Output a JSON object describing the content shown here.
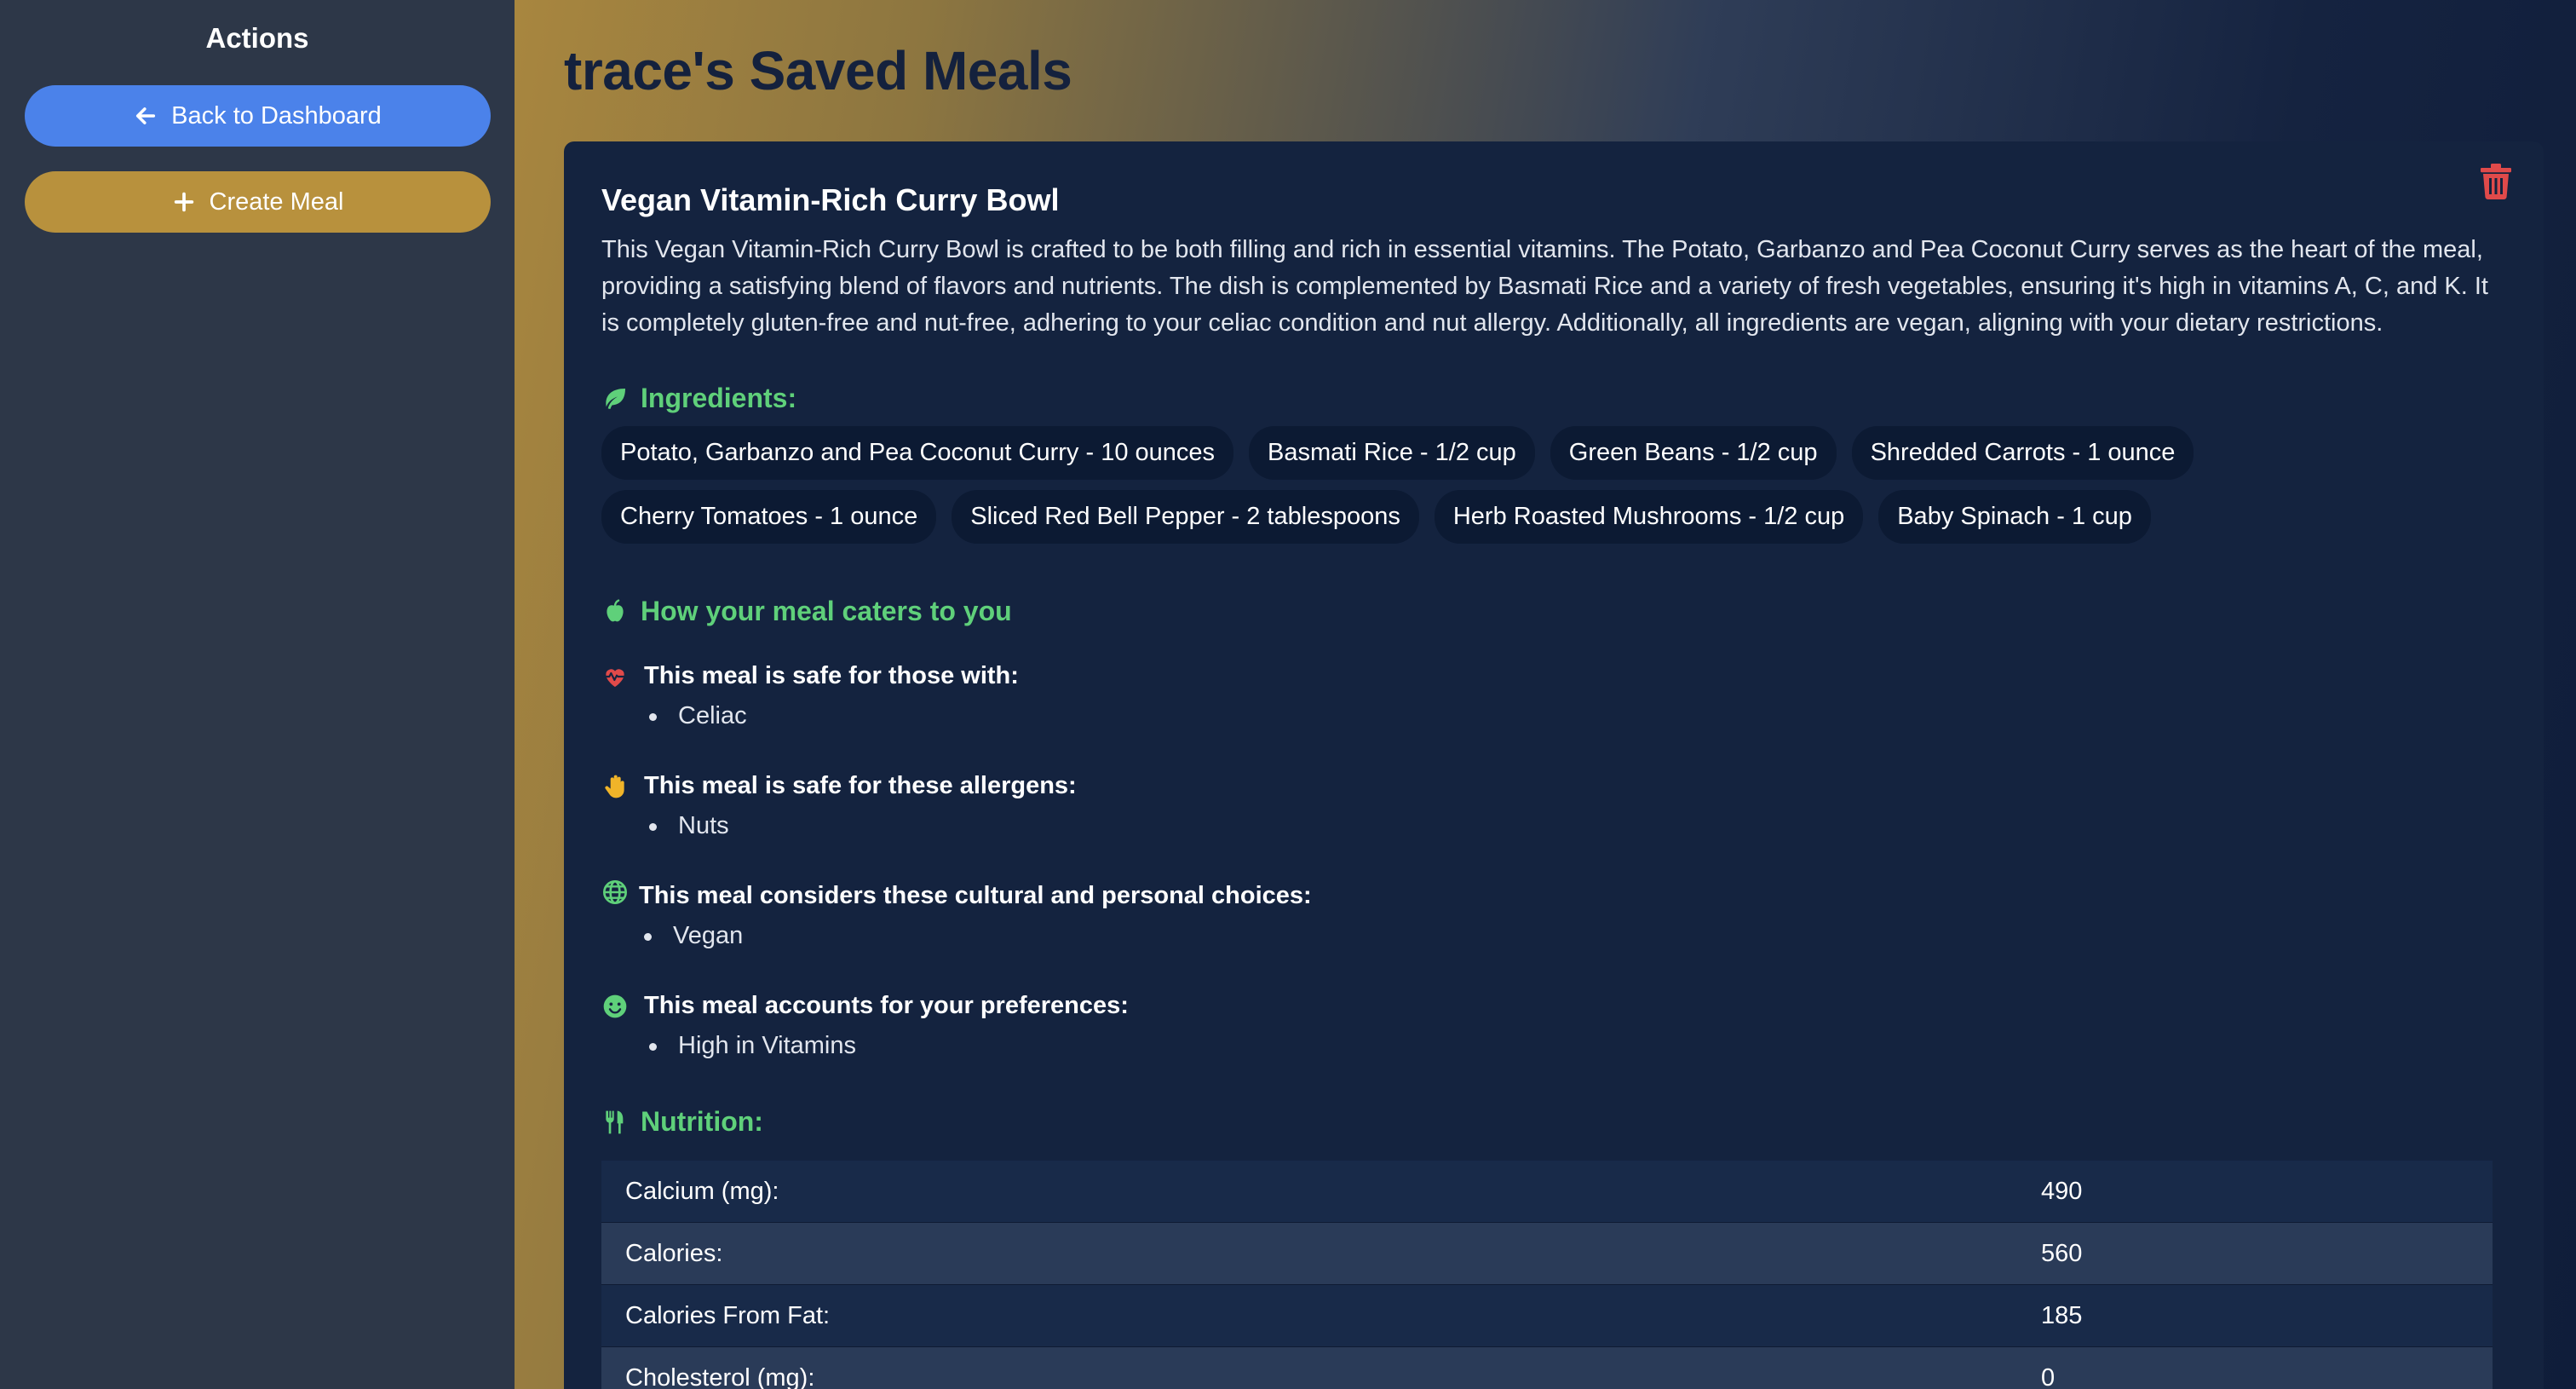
{
  "sidebar": {
    "title": "Actions",
    "back_label": "Back to Dashboard",
    "create_label": "Create Meal"
  },
  "page": {
    "title": "trace's Saved Meals"
  },
  "meal": {
    "name": "Vegan Vitamin-Rich Curry Bowl",
    "description": "This Vegan Vitamin-Rich Curry Bowl is crafted to be both filling and rich in essential vitamins. The Potato, Garbanzo and Pea Coconut Curry serves as the heart of the meal, providing a satisfying blend of flavors and nutrients. The dish is complemented by Basmati Rice and a variety of fresh vegetables, ensuring it's high in vitamins A, C, and K. It is completely gluten-free and nut-free, adhering to your celiac condition and nut allergy. Additionally, all ingredients are vegan, aligning with your dietary restrictions.",
    "ingredients_heading": "Ingredients:",
    "ingredients": [
      "Potato, Garbanzo and Pea Coconut Curry - 10 ounces",
      "Basmati Rice - 1/2 cup",
      "Green Beans - 1/2 cup",
      "Shredded Carrots - 1 ounce",
      "Cherry Tomatoes - 1 ounce",
      "Sliced Red Bell Pepper - 2 tablespoons",
      "Herb Roasted Mushrooms - 1/2 cup",
      "Baby Spinach - 1 cup"
    ],
    "caters_heading": "How your meal caters to you",
    "conditions": {
      "heading": "This meal is safe for those with:",
      "items": [
        "Celiac"
      ]
    },
    "allergens": {
      "heading": "This meal is safe for these allergens:",
      "items": [
        "Nuts"
      ]
    },
    "cultural": {
      "heading": "This meal considers these cultural and personal choices:",
      "items": [
        "Vegan"
      ]
    },
    "preferences": {
      "heading": "This meal accounts for your preferences:",
      "items": [
        "High in Vitamins"
      ]
    },
    "nutrition_heading": "Nutrition:",
    "nutrition": [
      {
        "label": "Calcium (mg):",
        "value": "490"
      },
      {
        "label": "Calories:",
        "value": "560"
      },
      {
        "label": "Calories From Fat:",
        "value": "185"
      },
      {
        "label": "Cholesterol (mg):",
        "value": "0"
      }
    ]
  },
  "colors": {
    "accent_blue": "#4b82ea",
    "accent_gold": "#b8913d",
    "heading_green": "#5fd07a",
    "delete_red": "#e04a4a",
    "card_bg": "#14233f"
  },
  "icons": [
    "arrow-left-icon",
    "plus-icon",
    "trash-icon",
    "leaf-icon",
    "apple-icon",
    "heart-pulse-icon",
    "hand-icon",
    "globe-icon",
    "smile-icon",
    "utensils-icon"
  ]
}
